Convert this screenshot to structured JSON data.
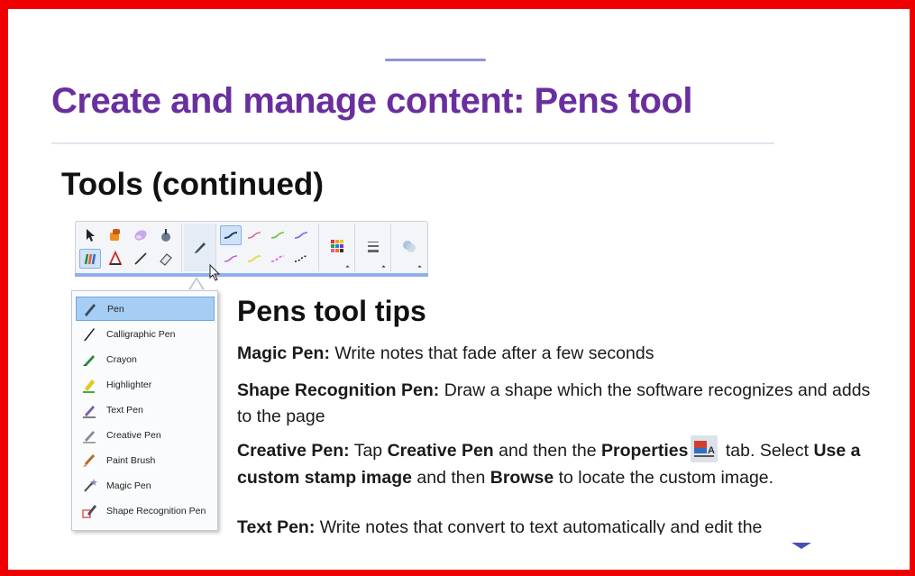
{
  "slide": {
    "title": "Create and manage content: Pens tool",
    "subtitle": "Tools (continued)"
  },
  "toolbar": {
    "groups": [
      {
        "name": "basic-tools",
        "buttons": [
          "select-arrow-icon",
          "fill-icon",
          "eraser-icon",
          "magic-wand-icon",
          "pens-icon",
          "shapes-icon",
          "line-icon",
          "eraser-block-icon"
        ]
      },
      {
        "name": "pen-style",
        "buttons": [
          "pen-icon"
        ]
      },
      {
        "name": "line-styles",
        "colors": [
          "#1a3f6f",
          "#e06a8a",
          "#6abf3a",
          "#6a6cf0",
          "#c060d0",
          "#e0e050",
          "#d060e0",
          "#222222"
        ]
      },
      {
        "name": "color",
        "buttons": [
          "color-palette-icon"
        ]
      },
      {
        "name": "thickness",
        "buttons": [
          "line-thickness-icon"
        ]
      },
      {
        "name": "transparency",
        "buttons": [
          "transparency-icon"
        ]
      }
    ]
  },
  "pens_menu": {
    "items": [
      {
        "label": "Pen",
        "icon": "pen-icon",
        "selected": true
      },
      {
        "label": "Calligraphic Pen",
        "icon": "calligraphic-pen-icon"
      },
      {
        "label": "Crayon",
        "icon": "crayon-icon"
      },
      {
        "label": "Highlighter",
        "icon": "highlighter-icon"
      },
      {
        "label": "Text Pen",
        "icon": "text-pen-icon"
      },
      {
        "label": "Creative Pen",
        "icon": "creative-pen-icon"
      },
      {
        "label": "Paint Brush",
        "icon": "paint-brush-icon"
      },
      {
        "label": "Magic Pen",
        "icon": "magic-pen-icon"
      },
      {
        "label": "Shape Recognition Pen",
        "icon": "shape-recognition-pen-icon"
      }
    ]
  },
  "tips": {
    "heading": "Pens tool tips",
    "magic": {
      "term": "Magic Pen:",
      "text": " Write notes that fade after a few seconds"
    },
    "shape": {
      "term": "Shape Recognition Pen:",
      "text": " Draw a shape which the software recognizes and adds to the page"
    },
    "creative": {
      "term": "Creative Pen:",
      "t1": " Tap ",
      "b1": "Creative Pen",
      "t2": " and then the ",
      "b2": "Properties",
      "t3": " tab. Select ",
      "b3": "Use a custom stamp image",
      "t4": " and then ",
      "b4": "Browse",
      "t5": " to locate the custom image."
    },
    "text_pen": {
      "term": "Text Pen:",
      "text": " Write notes that convert to text automatically and edit the"
    }
  },
  "colors": {
    "border": "#ee0000",
    "title": "#6a2f9e",
    "toolbar_accent": "#8fb0ee",
    "menu_selected": "#a6cdf3"
  }
}
